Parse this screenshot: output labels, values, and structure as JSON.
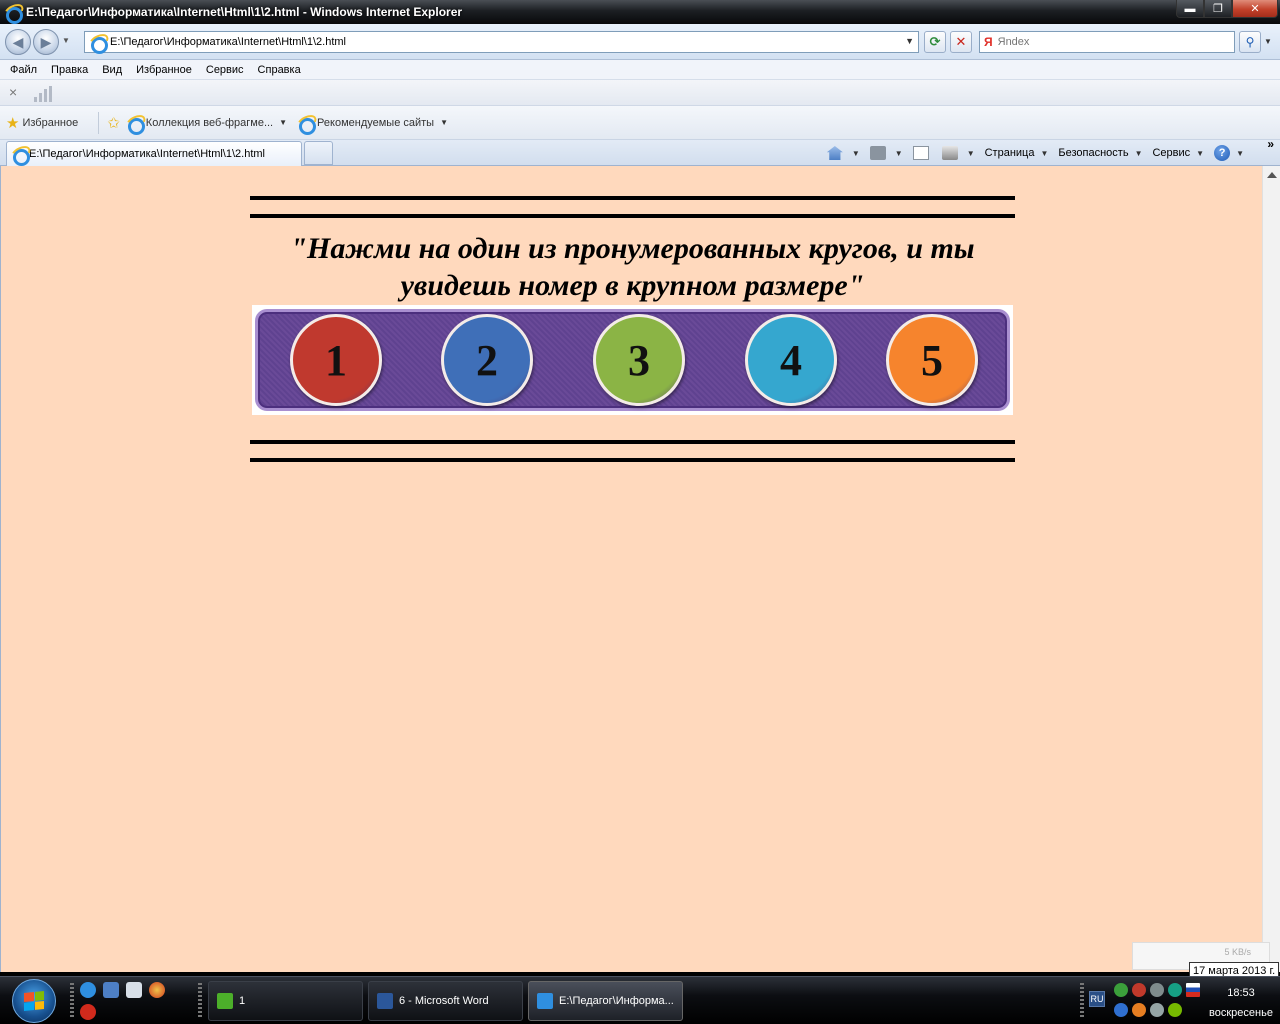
{
  "window": {
    "title": "E:\\Педагог\\Информатика\\Internet\\Html\\1\\2.html - Windows Internet Explorer",
    "buttons": {
      "minimize": "▬",
      "maximize": "❐",
      "close": "✕"
    }
  },
  "navigation": {
    "back_label": "◀",
    "forward_label": "▶",
    "address": "E:\\Педагог\\Информатика\\Internet\\Html\\1\\2.html",
    "search_engine": "Я",
    "search_placeholder": "Яndex",
    "search_go": "⚲",
    "refresh_label": "⟳",
    "stop_label": "✕"
  },
  "menu": [
    "Файл",
    "Правка",
    "Вид",
    "Избранное",
    "Сервис",
    "Справка"
  ],
  "toolbar2": {
    "close_label": "×"
  },
  "favorites": {
    "label": "Избранное",
    "items": [
      "Коллекция веб-фрагме...",
      "Рекомендуемые сайты"
    ]
  },
  "tabs": {
    "active_title": "E:\\Педагог\\Информатика\\Internet\\Html\\1\\2.html"
  },
  "commands": {
    "page": "Страница",
    "safety": "Безопасность",
    "tools": "Сервис",
    "help": "?",
    "more": "»"
  },
  "page": {
    "heading": "\"Нажми на один из пронумерованных кругов, и ты увидешь номер в крупном размере\"",
    "circles": [
      {
        "label": "1",
        "color": "#c0392e"
      },
      {
        "label": "2",
        "color": "#3f6fb8"
      },
      {
        "label": "3",
        "color": "#8bb445"
      },
      {
        "label": "4",
        "color": "#35a7cf"
      },
      {
        "label": "5",
        "color": "#f6842d"
      }
    ],
    "background": "#ffd9bd"
  },
  "status": {
    "net_speed": "5 KB/s",
    "date_tooltip": "17 марта 2013 г."
  },
  "taskbar": {
    "buttons": [
      {
        "label": "1",
        "icon_color": "#4caf2a"
      },
      {
        "label": "6 - Microsoft Word",
        "icon_color": "#2b579a"
      },
      {
        "label": "E:\\Педагог\\Информа...",
        "icon_color": "#2f8fe0"
      }
    ],
    "language": "RU",
    "time": "18:53",
    "day": "воскресенье"
  }
}
